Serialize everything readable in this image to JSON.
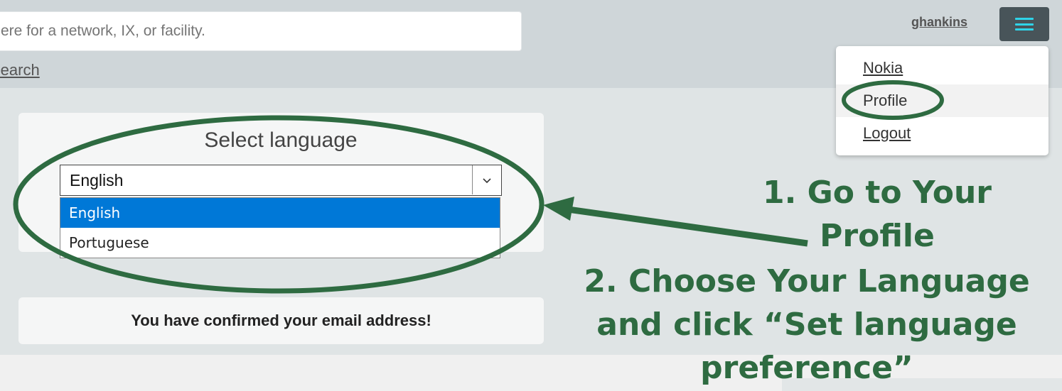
{
  "header": {
    "search_placeholder": "ere for a network, IX, or facility.",
    "advanced_search": "Search",
    "username": "ghankins",
    "menu_button": "hamburger-menu-icon"
  },
  "user_menu": {
    "items": [
      {
        "label": "Nokia"
      },
      {
        "label": "Profile"
      },
      {
        "label": "Logout"
      }
    ]
  },
  "language_card": {
    "title": "Select language",
    "selected_value": "English",
    "options": [
      "English",
      "Portuguese"
    ]
  },
  "email_card": {
    "message": "You have confirmed your email address!"
  },
  "annotations": {
    "step1": "1. Go to Your Profile",
    "step2": "2. Choose Your Language and click “Set language preference”"
  },
  "colors": {
    "annotation_green": "#2e6b41",
    "menu_button_bg": "#485459",
    "menu_icon": "#2fd3e8",
    "selected_option": "#0078d7",
    "topbar": "#cfd6d9",
    "page_bg": "#dfe4e5"
  }
}
